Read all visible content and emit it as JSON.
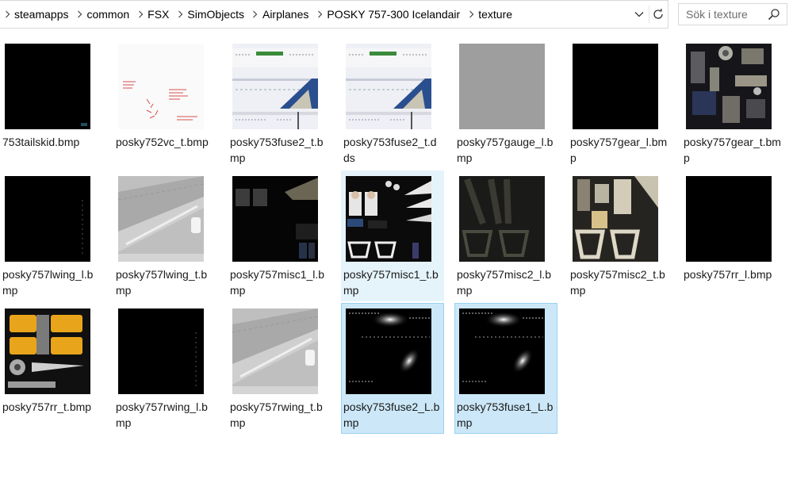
{
  "breadcrumb": [
    "steamapps",
    "common",
    "FSX",
    "SimObjects",
    "Airplanes",
    "POSKY 757-300 Icelandair",
    "texture"
  ],
  "search": {
    "placeholder": "Sök i texture"
  },
  "colors": {
    "selected_bg": "#cce8f8",
    "selected_border": "#99d1f3",
    "hover_bg": "#e5f3fb"
  },
  "files": [
    {
      "name": "753tailskid.bmp",
      "thumb": "black-dot",
      "state": "normal"
    },
    {
      "name": "posky752vc_t.bmp",
      "thumb": "white-red",
      "state": "normal"
    },
    {
      "name": "posky753fuse2_t.bmp",
      "thumb": "fuselage",
      "state": "normal"
    },
    {
      "name": "posky753fuse2_t.dds",
      "thumb": "fuselage",
      "state": "normal"
    },
    {
      "name": "posky757gauge_l.bmp",
      "thumb": "gray",
      "state": "normal"
    },
    {
      "name": "posky757gear_l.bmp",
      "thumb": "black",
      "state": "normal"
    },
    {
      "name": "posky757gear_t.bmp",
      "thumb": "gear",
      "state": "normal"
    },
    {
      "name": "posky757lwing_l.bmp",
      "thumb": "black-faint",
      "state": "normal"
    },
    {
      "name": "posky757lwing_t.bmp",
      "thumb": "wing",
      "state": "normal"
    },
    {
      "name": "posky757misc1_l.bmp",
      "thumb": "misc-dark",
      "state": "normal"
    },
    {
      "name": "posky757misc1_t.bmp",
      "thumb": "misc",
      "state": "hover"
    },
    {
      "name": "posky757misc2_l.bmp",
      "thumb": "misc2-dark",
      "state": "normal"
    },
    {
      "name": "posky757misc2_t.bmp",
      "thumb": "misc2",
      "state": "normal"
    },
    {
      "name": "posky757rr_l.bmp",
      "thumb": "black",
      "state": "normal"
    },
    {
      "name": "posky757rr_t.bmp",
      "thumb": "engine",
      "state": "normal"
    },
    {
      "name": "posky757rwing_l.bmp",
      "thumb": "black-faint",
      "state": "normal"
    },
    {
      "name": "posky757rwing_t.bmp",
      "thumb": "wing",
      "state": "normal"
    },
    {
      "name": "posky753fuse2_L.bmp",
      "thumb": "light",
      "state": "selected"
    },
    {
      "name": "posky753fuse1_L.bmp",
      "thumb": "light",
      "state": "selected"
    }
  ]
}
